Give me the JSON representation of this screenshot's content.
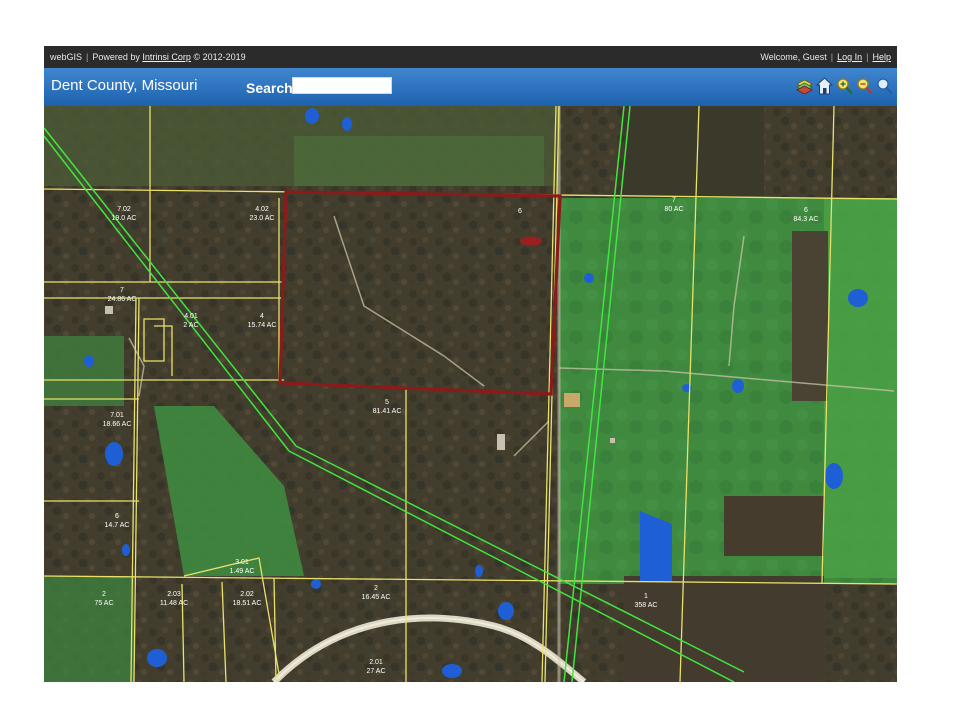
{
  "topbar": {
    "app_name": "webGIS",
    "powered_by": "Powered by",
    "vendor_link": "Intrinsi Corp",
    "copyright": "© 2012-2019",
    "welcome": "Welcome, Guest",
    "login_link": "Log In",
    "help_link": "Help"
  },
  "header": {
    "county": "Dent County, Missouri",
    "search_label": "Search:",
    "search_value": "",
    "tools": [
      "layers-icon",
      "home-icon",
      "zoom-in-icon",
      "zoom-out-icon",
      "search-icon"
    ]
  },
  "map": {
    "highlight_color": "#8b1a1a",
    "parcel_line_color": "#e9e16a",
    "powerline_color": "#3fe63f",
    "parcels": [
      {
        "id": "7.02",
        "area": "19.0 AC"
      },
      {
        "id": "4.02",
        "area": "23.0 AC"
      },
      {
        "id": "6",
        "area": ""
      },
      {
        "id": "7",
        "area": "80 AC"
      },
      {
        "id": "6",
        "area": "84.3 AC"
      },
      {
        "id": "7",
        "area": "24.86 AC"
      },
      {
        "id": "4.01",
        "area": "2 AC"
      },
      {
        "id": "4",
        "area": "15.74 AC"
      },
      {
        "id": "5",
        "area": "81.41 AC"
      },
      {
        "id": "7.01",
        "area": "18.66 AC"
      },
      {
        "id": "6",
        "area": "14.7 AC"
      },
      {
        "id": "3.01",
        "area": "1.49 AC"
      },
      {
        "id": "2",
        "area": "75 AC"
      },
      {
        "id": "2.03",
        "area": "11.48 AC"
      },
      {
        "id": "2.02",
        "area": "18.51 AC"
      },
      {
        "id": "2",
        "area": "16.45 AC"
      },
      {
        "id": "1",
        "area": "358 AC"
      },
      {
        "id": "2.01",
        "area": "27 AC"
      }
    ]
  }
}
